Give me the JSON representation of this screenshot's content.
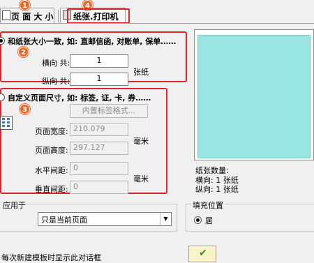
{
  "tabs": [
    {
      "label": "页 面 大 小",
      "badge": "1"
    },
    {
      "label": "纸张.打印机",
      "badge": "4"
    }
  ],
  "section1": {
    "badge": "2",
    "radio_label": "和纸张大小一致, 如: 直邮信函, 对账单, 保单……",
    "horizontal_label": "横向 共:",
    "horizontal_value": "1",
    "vertical_label": "纵向 共:",
    "vertical_value": "1",
    "unit": "张纸"
  },
  "section2": {
    "badge": "3",
    "radio_label": "自定义页面尺寸, 如: 标签, 证, 卡, 券……",
    "builtin_button": "内置标签格式...",
    "page_width_label": "页面宽度:",
    "page_width_value": "210.079",
    "page_height_label": "页面高度:",
    "page_height_value": "297.127",
    "size_unit": "毫米",
    "h_gap_label": "水平间距:",
    "h_gap_value": "0",
    "v_gap_label": "垂直间距:",
    "v_gap_value": "0",
    "gap_unit": "毫米"
  },
  "preview": {
    "sheet_count_label": "纸张数量:",
    "horizontal_line": "横向: 1 张纸",
    "vertical_line": "纵向: 1 张纸",
    "fill_color": "#99e5e1"
  },
  "apply": {
    "group_label": "应用于",
    "selected": "只是当前页面"
  },
  "fill_position": {
    "group_label": "填充位置",
    "option_partial": "居"
  },
  "footer": {
    "text": "每次新建模板时显示此对话框"
  },
  "colors": {
    "highlight": "#d9262b",
    "badge": "#e8672a"
  }
}
